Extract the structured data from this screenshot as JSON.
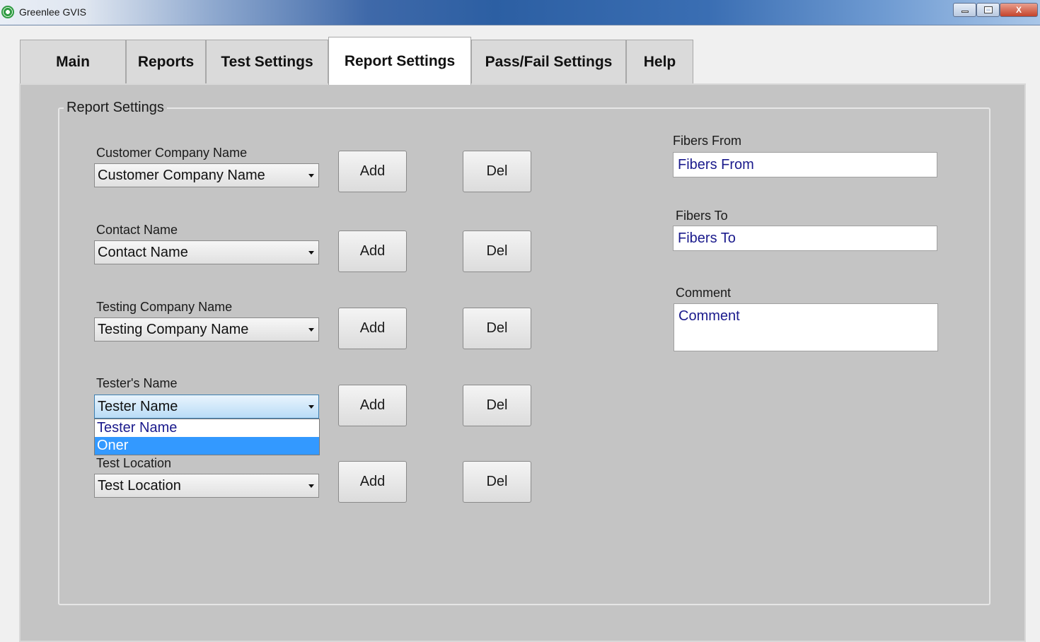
{
  "window": {
    "title": "Greenlee GVIS",
    "close_glyph": "X"
  },
  "tabs": [
    {
      "label": "Main"
    },
    {
      "label": "Reports"
    },
    {
      "label": "Test Settings"
    },
    {
      "label": "Report Settings"
    },
    {
      "label": "Pass/Fail Settings"
    },
    {
      "label": "Help"
    }
  ],
  "group": {
    "title": "Report Settings"
  },
  "fields": [
    {
      "label": "Customer Company Name",
      "value": "Customer Company Name"
    },
    {
      "label": "Contact Name",
      "value": "Contact Name"
    },
    {
      "label": "Testing Company Name",
      "value": "Testing Company Name"
    },
    {
      "label": "Tester's Name",
      "value": "Tester Name"
    },
    {
      "label": "Test Location",
      "value": "Test Location"
    }
  ],
  "buttons": {
    "add": "Add",
    "del": "Del"
  },
  "dropdown": {
    "options": [
      "Tester Name",
      "Oner"
    ],
    "highlighted": "Oner"
  },
  "right": {
    "fibers_from": {
      "label": "Fibers From",
      "value": "Fibers From"
    },
    "fibers_to": {
      "label": "Fibers To",
      "value": "Fibers To"
    },
    "comment": {
      "label": "Comment",
      "value": "Comment"
    }
  },
  "colors": {
    "highlight": "#3399ff",
    "input_text": "#1a1a8c",
    "panel": "#c4c4c4"
  }
}
